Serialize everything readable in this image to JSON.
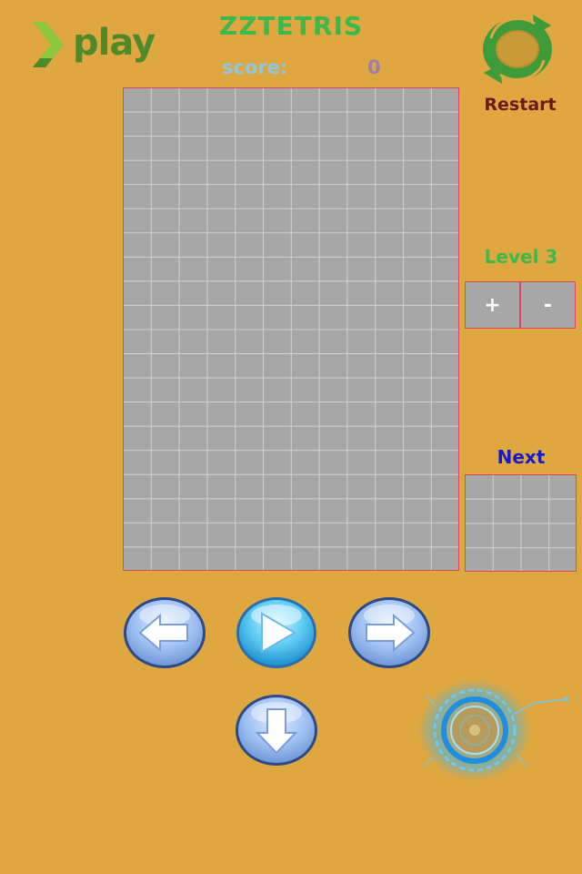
{
  "header": {
    "logo_text": "play",
    "title": "ZZTETRIS",
    "score_label": "score:",
    "score_value": "0"
  },
  "restart": {
    "label": "Restart",
    "icon": "restart-icon"
  },
  "level": {
    "label": "Level 3",
    "plus_label": "+",
    "minus_label": "-"
  },
  "next": {
    "label": "Next"
  },
  "controls": {
    "left": "arrow-left-icon",
    "play": "play-icon",
    "right": "arrow-right-icon",
    "down": "arrow-down-icon",
    "extra": "glowing-portal-icon"
  },
  "colors": {
    "background": "#DFA73F",
    "title": "#3DB84C",
    "board": "#A7A7A7",
    "grid_line": "#D2D2D2",
    "border": "#E0475A",
    "next_label": "#1A1ACB",
    "restart_label": "#6A1A1A"
  }
}
